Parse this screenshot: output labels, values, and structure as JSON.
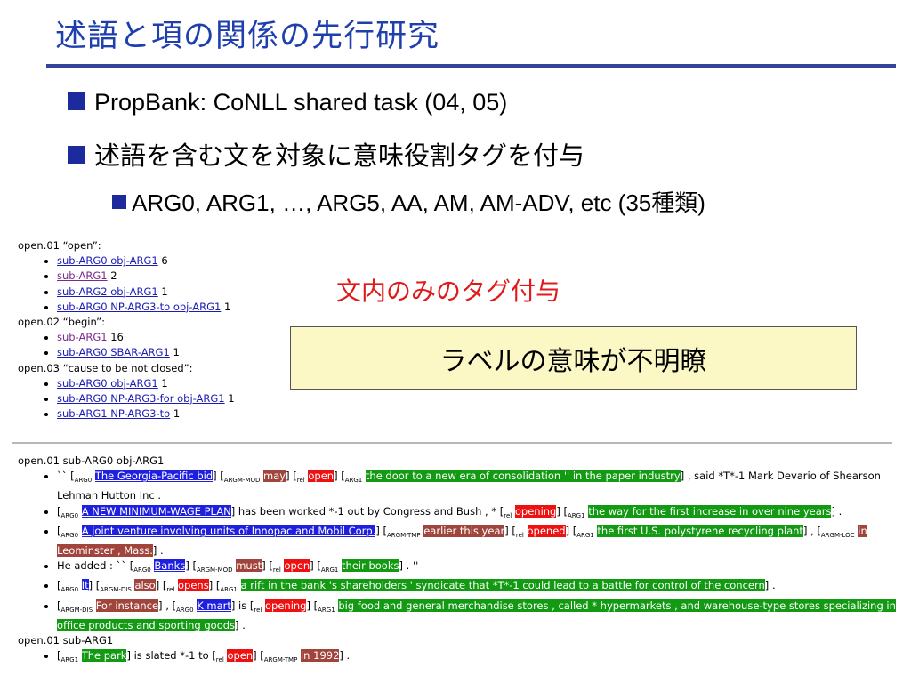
{
  "title": "述語と項の関係の先行研究",
  "bullets": [
    "PropBank: CoNLL shared task (04, 05)",
    "述語を含む文を対象に意味役割タグを付与"
  ],
  "sub_bullet": "ARG0, ARG1, …, ARG5, AA, AM, AM-ADV, etc (35種類)",
  "annotation_red": "文内のみのタグ付与",
  "annotation_box": "ラベルの意味が不明瞭",
  "colors": {
    "title": "#1f3fae",
    "bullet_square": "#1c2a9c",
    "red": "#e0191a",
    "box_bg": "#fbf8c6"
  },
  "frames": [
    {
      "head": "open.01 “open”:",
      "items": [
        {
          "link": "sub-ARG0 obj-ARG1",
          "count": "6"
        },
        {
          "link": "sub-ARG1",
          "count": "2"
        },
        {
          "link": "sub-ARG2 obj-ARG1",
          "count": "1"
        },
        {
          "link": "sub-ARG0 NP-ARG3-to obj-ARG1",
          "count": "1"
        }
      ]
    },
    {
      "head": "open.02 “begin”:",
      "items": [
        {
          "link": "sub-ARG1",
          "count": "16"
        },
        {
          "link": "sub-ARG0 SBAR-ARG1",
          "count": "1"
        }
      ]
    },
    {
      "head": "open.03 “cause to be not closed”:",
      "items": [
        {
          "link": "sub-ARG0 obj-ARG1",
          "count": "1"
        },
        {
          "link": "sub-ARG0 NP-ARG3-for obj-ARG1",
          "count": "1"
        },
        {
          "link": "sub-ARG1 NP-ARG3-to",
          "count": "1"
        }
      ]
    }
  ],
  "examples": {
    "head1": "open.01 sub-ARG0 obj-ARG1",
    "s1": {
      "pre": "`` [",
      "a0": "ARG0",
      "t0": "The Georgia-Pacific bid",
      "am": "ARGM-MOD",
      "tm": "may",
      "rel": "rel",
      "tr": "open",
      "a1": "ARG1",
      "t1": "the door to a new era of consolidation '' in the paper industry",
      "post": "] , said *T*-1 Mark Devario of Shearson Lehman Hutton Inc ."
    },
    "s2": {
      "a0": "ARG0",
      "t0": "A NEW MINIMUM-WAGE PLAN",
      "mid": "] has been worked *-1 out by Congress and Bush , * [",
      "rel": "rel",
      "tr": "opening",
      "a1": "ARG1",
      "t1": "the way for the first increase in over nine years",
      "post": "] ."
    },
    "s3": {
      "a0": "ARG0",
      "t0": "A joint venture involving units of Innopac and Mobil Corp.",
      "at": "ARGM-TMP",
      "tt": "earlier this year",
      "rel": "rel",
      "tr": "opened",
      "a1": "ARG1",
      "t1": "the first U.S. polystyrene recycling plant",
      "al": "ARGM-LOC",
      "tl": "in Leominster , Mass.",
      "post": "] ."
    },
    "s4": {
      "pre": "He added : `` [",
      "a0": "ARG0",
      "t0": "Banks",
      "am": "ARGM-MOD",
      "tm": "must",
      "rel": "rel",
      "tr": "open",
      "a1": "ARG1",
      "t1": "their books",
      "post": "] . ''"
    },
    "s5": {
      "a0": "ARG0",
      "t0": "It",
      "ad": "ARGM-DIS",
      "td": "also",
      "rel": "rel",
      "tr": "opens",
      "a1": "ARG1",
      "t1": "a rift in the bank 's shareholders ' syndicate that *T*-1 could lead to a battle for control of the concern",
      "post": "] ."
    },
    "s6": {
      "ad": "ARGM-DIS",
      "td": "For instance",
      "a0": "ARG0",
      "t0": "K mart",
      "mid": "] is [",
      "rel": "rel",
      "tr": "opening",
      "a1": "ARG1",
      "t1": "big food and general merchandise stores , called * hypermarkets , and warehouse-type stores specializing in office products and sporting goods",
      "post": "] ."
    },
    "head2": "open.01 sub-ARG1",
    "s7": {
      "a1": "ARG1",
      "t1": "The park",
      "mid": "] is slated *-1 to [",
      "rel": "rel",
      "tr": "open",
      "at": "ARGM-TMP",
      "tt": "in 1992",
      "post": "] ."
    }
  }
}
